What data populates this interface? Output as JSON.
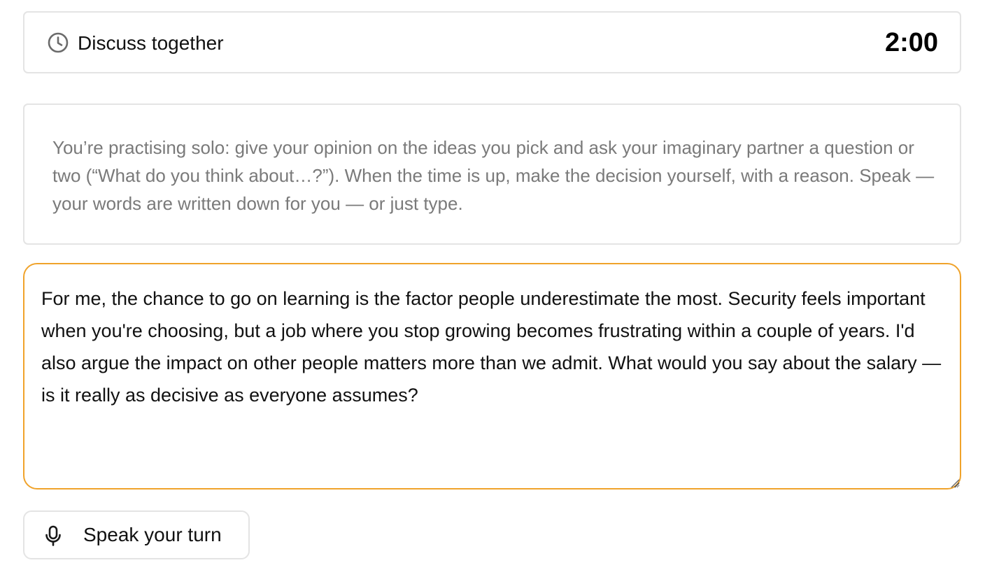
{
  "header": {
    "icon": "clock-icon",
    "title": "Discuss together",
    "timer": "2:00"
  },
  "instructions": {
    "text": "You’re practising solo: give your opinion on the ideas you pick and ask your imaginary partner a question or two (“What do you think about…?”). When the time is up, make the decision yourself, with a reason. Speak — your words are written down for you — or just type."
  },
  "answer": {
    "value": "For me, the chance to go on learning is the factor people underestimate the most. Security feels important when you're choosing, but a job where you stop growing becomes frustrating within a couple of years. I'd also argue the impact on other people matters more than we admit. What would you say about the salary — is it really as decisive as everyone assumes?",
    "border_color": "#f0a32b"
  },
  "speak_button": {
    "icon": "microphone-icon",
    "label": "Speak your turn"
  }
}
